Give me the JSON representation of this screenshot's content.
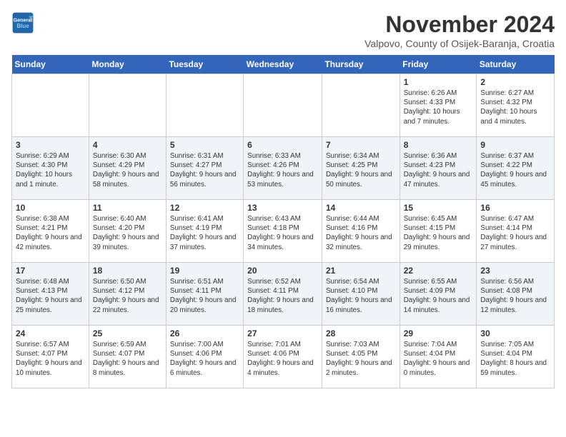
{
  "header": {
    "logo_line1": "General",
    "logo_line2": "Blue",
    "month": "November 2024",
    "location": "Valpovo, County of Osijek-Baranja, Croatia"
  },
  "days_of_week": [
    "Sunday",
    "Monday",
    "Tuesday",
    "Wednesday",
    "Thursday",
    "Friday",
    "Saturday"
  ],
  "weeks": [
    [
      {
        "day": "",
        "info": ""
      },
      {
        "day": "",
        "info": ""
      },
      {
        "day": "",
        "info": ""
      },
      {
        "day": "",
        "info": ""
      },
      {
        "day": "",
        "info": ""
      },
      {
        "day": "1",
        "info": "Sunrise: 6:26 AM\nSunset: 4:33 PM\nDaylight: 10 hours and 7 minutes."
      },
      {
        "day": "2",
        "info": "Sunrise: 6:27 AM\nSunset: 4:32 PM\nDaylight: 10 hours and 4 minutes."
      }
    ],
    [
      {
        "day": "3",
        "info": "Sunrise: 6:29 AM\nSunset: 4:30 PM\nDaylight: 10 hours and 1 minute."
      },
      {
        "day": "4",
        "info": "Sunrise: 6:30 AM\nSunset: 4:29 PM\nDaylight: 9 hours and 58 minutes."
      },
      {
        "day": "5",
        "info": "Sunrise: 6:31 AM\nSunset: 4:27 PM\nDaylight: 9 hours and 56 minutes."
      },
      {
        "day": "6",
        "info": "Sunrise: 6:33 AM\nSunset: 4:26 PM\nDaylight: 9 hours and 53 minutes."
      },
      {
        "day": "7",
        "info": "Sunrise: 6:34 AM\nSunset: 4:25 PM\nDaylight: 9 hours and 50 minutes."
      },
      {
        "day": "8",
        "info": "Sunrise: 6:36 AM\nSunset: 4:23 PM\nDaylight: 9 hours and 47 minutes."
      },
      {
        "day": "9",
        "info": "Sunrise: 6:37 AM\nSunset: 4:22 PM\nDaylight: 9 hours and 45 minutes."
      }
    ],
    [
      {
        "day": "10",
        "info": "Sunrise: 6:38 AM\nSunset: 4:21 PM\nDaylight: 9 hours and 42 minutes."
      },
      {
        "day": "11",
        "info": "Sunrise: 6:40 AM\nSunset: 4:20 PM\nDaylight: 9 hours and 39 minutes."
      },
      {
        "day": "12",
        "info": "Sunrise: 6:41 AM\nSunset: 4:19 PM\nDaylight: 9 hours and 37 minutes."
      },
      {
        "day": "13",
        "info": "Sunrise: 6:43 AM\nSunset: 4:18 PM\nDaylight: 9 hours and 34 minutes."
      },
      {
        "day": "14",
        "info": "Sunrise: 6:44 AM\nSunset: 4:16 PM\nDaylight: 9 hours and 32 minutes."
      },
      {
        "day": "15",
        "info": "Sunrise: 6:45 AM\nSunset: 4:15 PM\nDaylight: 9 hours and 29 minutes."
      },
      {
        "day": "16",
        "info": "Sunrise: 6:47 AM\nSunset: 4:14 PM\nDaylight: 9 hours and 27 minutes."
      }
    ],
    [
      {
        "day": "17",
        "info": "Sunrise: 6:48 AM\nSunset: 4:13 PM\nDaylight: 9 hours and 25 minutes."
      },
      {
        "day": "18",
        "info": "Sunrise: 6:50 AM\nSunset: 4:12 PM\nDaylight: 9 hours and 22 minutes."
      },
      {
        "day": "19",
        "info": "Sunrise: 6:51 AM\nSunset: 4:11 PM\nDaylight: 9 hours and 20 minutes."
      },
      {
        "day": "20",
        "info": "Sunrise: 6:52 AM\nSunset: 4:11 PM\nDaylight: 9 hours and 18 minutes."
      },
      {
        "day": "21",
        "info": "Sunrise: 6:54 AM\nSunset: 4:10 PM\nDaylight: 9 hours and 16 minutes."
      },
      {
        "day": "22",
        "info": "Sunrise: 6:55 AM\nSunset: 4:09 PM\nDaylight: 9 hours and 14 minutes."
      },
      {
        "day": "23",
        "info": "Sunrise: 6:56 AM\nSunset: 4:08 PM\nDaylight: 9 hours and 12 minutes."
      }
    ],
    [
      {
        "day": "24",
        "info": "Sunrise: 6:57 AM\nSunset: 4:07 PM\nDaylight: 9 hours and 10 minutes."
      },
      {
        "day": "25",
        "info": "Sunrise: 6:59 AM\nSunset: 4:07 PM\nDaylight: 9 hours and 8 minutes."
      },
      {
        "day": "26",
        "info": "Sunrise: 7:00 AM\nSunset: 4:06 PM\nDaylight: 9 hours and 6 minutes."
      },
      {
        "day": "27",
        "info": "Sunrise: 7:01 AM\nSunset: 4:06 PM\nDaylight: 9 hours and 4 minutes."
      },
      {
        "day": "28",
        "info": "Sunrise: 7:03 AM\nSunset: 4:05 PM\nDaylight: 9 hours and 2 minutes."
      },
      {
        "day": "29",
        "info": "Sunrise: 7:04 AM\nSunset: 4:04 PM\nDaylight: 9 hours and 0 minutes."
      },
      {
        "day": "30",
        "info": "Sunrise: 7:05 AM\nSunset: 4:04 PM\nDaylight: 8 hours and 59 minutes."
      }
    ]
  ]
}
